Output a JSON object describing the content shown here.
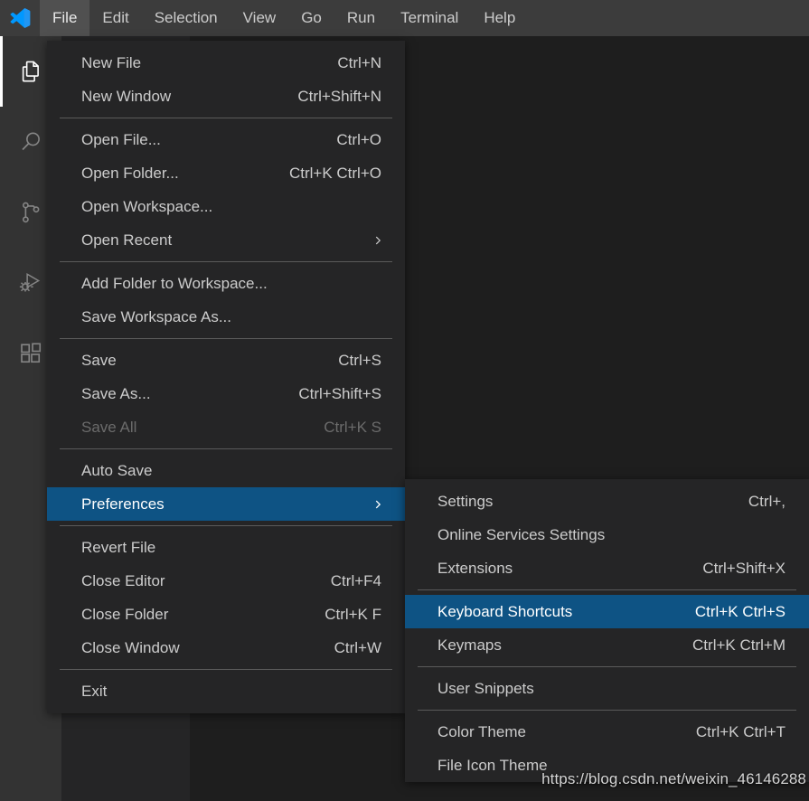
{
  "app": {
    "title": "Visual Studio Code",
    "logo_icon": "vscode-logo-icon",
    "theme_colors": {
      "titlebar_bg": "#3c3c3c",
      "activitybar_bg": "#333333",
      "sidebar_bg": "#252526",
      "editor_bg": "#1e1e1e",
      "menu_bg": "#252526",
      "menu_text": "#cccccc",
      "menu_disabled_text": "#6b6b6b",
      "selection_bg": "#0e5384",
      "separator": "#5a5a5a",
      "accent_blue": "#0098ff"
    }
  },
  "menubar": {
    "items": [
      {
        "label": "File",
        "active": true
      },
      {
        "label": "Edit",
        "active": false
      },
      {
        "label": "Selection",
        "active": false
      },
      {
        "label": "View",
        "active": false
      },
      {
        "label": "Go",
        "active": false
      },
      {
        "label": "Run",
        "active": false
      },
      {
        "label": "Terminal",
        "active": false
      },
      {
        "label": "Help",
        "active": false
      }
    ]
  },
  "activitybar": {
    "items": [
      {
        "name": "explorer",
        "icon": "files-icon",
        "title": "Explorer",
        "active": true
      },
      {
        "name": "search",
        "icon": "search-icon",
        "title": "Search",
        "active": false
      },
      {
        "name": "source-control",
        "icon": "branch-icon",
        "title": "Source Control",
        "active": false
      },
      {
        "name": "run-debug",
        "icon": "run-debug-icon",
        "title": "Run and Debug",
        "active": false
      },
      {
        "name": "extensions",
        "icon": "extensions-icon",
        "title": "Extensions",
        "active": false
      }
    ]
  },
  "file_menu": {
    "name": "File",
    "entries": [
      {
        "type": "item",
        "label": "New File",
        "accel": "Ctrl+N"
      },
      {
        "type": "item",
        "label": "New Window",
        "accel": "Ctrl+Shift+N"
      },
      {
        "type": "sep"
      },
      {
        "type": "item",
        "label": "Open File...",
        "accel": "Ctrl+O"
      },
      {
        "type": "item",
        "label": "Open Folder...",
        "accel": "Ctrl+K Ctrl+O"
      },
      {
        "type": "item",
        "label": "Open Workspace...",
        "accel": ""
      },
      {
        "type": "item",
        "label": "Open Recent",
        "accel": "",
        "submenu": true
      },
      {
        "type": "sep"
      },
      {
        "type": "item",
        "label": "Add Folder to Workspace...",
        "accel": ""
      },
      {
        "type": "item",
        "label": "Save Workspace As...",
        "accel": ""
      },
      {
        "type": "sep"
      },
      {
        "type": "item",
        "label": "Save",
        "accel": "Ctrl+S"
      },
      {
        "type": "item",
        "label": "Save As...",
        "accel": "Ctrl+Shift+S"
      },
      {
        "type": "item",
        "label": "Save All",
        "accel": "Ctrl+K S",
        "disabled": true
      },
      {
        "type": "sep"
      },
      {
        "type": "item",
        "label": "Auto Save",
        "accel": ""
      },
      {
        "type": "item",
        "label": "Preferences",
        "accel": "",
        "submenu": true,
        "selected": true
      },
      {
        "type": "sep"
      },
      {
        "type": "item",
        "label": "Revert File",
        "accel": ""
      },
      {
        "type": "item",
        "label": "Close Editor",
        "accel": "Ctrl+F4"
      },
      {
        "type": "item",
        "label": "Close Folder",
        "accel": "Ctrl+K F"
      },
      {
        "type": "item",
        "label": "Close Window",
        "accel": "Ctrl+W"
      },
      {
        "type": "sep"
      },
      {
        "type": "item",
        "label": "Exit",
        "accel": ""
      }
    ]
  },
  "preferences_submenu": {
    "name": "Preferences",
    "entries": [
      {
        "type": "item",
        "label": "Settings",
        "accel": "Ctrl+,"
      },
      {
        "type": "item",
        "label": "Online Services Settings",
        "accel": ""
      },
      {
        "type": "item",
        "label": "Extensions",
        "accel": "Ctrl+Shift+X"
      },
      {
        "type": "sep"
      },
      {
        "type": "item",
        "label": "Keyboard Shortcuts",
        "accel": "Ctrl+K Ctrl+S",
        "selected": true
      },
      {
        "type": "item",
        "label": "Keymaps",
        "accel": "Ctrl+K Ctrl+M"
      },
      {
        "type": "sep"
      },
      {
        "type": "item",
        "label": "User Snippets",
        "accel": ""
      },
      {
        "type": "sep"
      },
      {
        "type": "item",
        "label": "Color Theme",
        "accel": "Ctrl+K Ctrl+T"
      },
      {
        "type": "item",
        "label": "File Icon Theme",
        "accel": ""
      }
    ]
  },
  "watermark": {
    "text": "https://blog.csdn.net/weixin_46146288"
  }
}
